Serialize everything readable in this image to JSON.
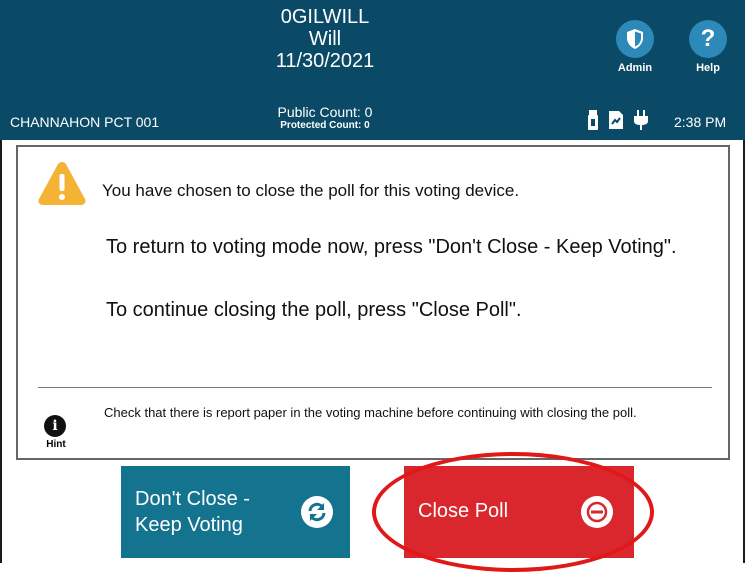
{
  "header": {
    "election_code": "0GILWILL",
    "county": "Will",
    "date": "11/30/2021",
    "admin_label": "Admin",
    "help_label": "Help",
    "precinct": "CHANNAHON PCT 001",
    "public_count": "Public Count: 0",
    "protected_count": "Protected Count: 0",
    "time": "2:38 PM",
    "status_icons": [
      "usb-icon",
      "document-icon",
      "power-plug-icon"
    ]
  },
  "dialog": {
    "message": "You have chosen to close the poll for this voting device.",
    "return_instruction": "To return to voting mode now, press \"Don't Close - Keep Voting\".",
    "continue_instruction": "To continue closing the poll, press \"Close Poll\".",
    "hint_label": "Hint",
    "hint_text": "Check that there is report paper in the voting machine before continuing with closing the poll."
  },
  "buttons": {
    "keep_voting_line1": "Don't Close -",
    "keep_voting_line2": "Keep Voting",
    "close_poll": "Close Poll"
  },
  "colors": {
    "header_bg": "#0b4a66",
    "header_button": "#2d89b8",
    "keep_voting_bg": "#14738f",
    "close_poll_bg": "#d9272d",
    "warning": "#f5b335",
    "highlight_circle": "#e01818"
  }
}
